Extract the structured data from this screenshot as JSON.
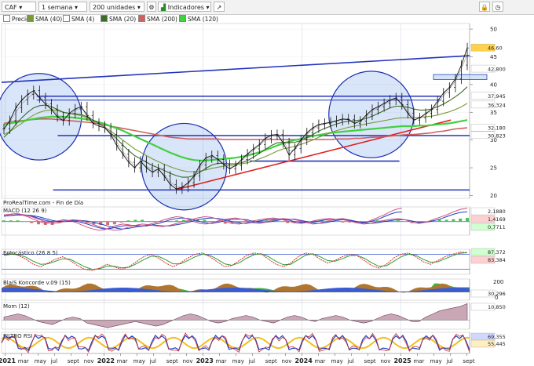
{
  "toolbar": {
    "symbol": "CAF",
    "interval": "1 semana",
    "units": "200 unidades",
    "indicators_label": "Indicadores",
    "colors": {
      "bg": "#f2f2f2"
    }
  },
  "legend": [
    {
      "label": "Precio",
      "color": "#ffffff"
    },
    {
      "label": "SMA (40)",
      "color": "#7a9a3a"
    },
    {
      "label": "SMA (4)",
      "color": "#ffffff"
    },
    {
      "label": "SMA (20)",
      "color": "#3c6a2a"
    },
    {
      "label": "SMA (200)",
      "color": "#d06060"
    },
    {
      "label": "SMA (120)",
      "color": "#40d040"
    }
  ],
  "source_note": "ProRealTime.com - Fin de Día",
  "chart_data": [
    {
      "type": "line",
      "panel": "price",
      "ylim": [
        19.5,
        51
      ],
      "yticks": [
        20,
        25,
        30,
        35,
        40,
        45,
        50
      ],
      "price_labels": [
        {
          "text": "46,60",
          "value": 46.6,
          "color": "#ffd24a"
        },
        {
          "text": "42,800",
          "value": 42.8,
          "color": "#ffffff"
        },
        {
          "text": "37,945",
          "value": 37.945,
          "color": "#ffffff"
        },
        {
          "text": "36,324",
          "value": 36.324,
          "color": "#ffffff"
        },
        {
          "text": "32,180",
          "value": 32.18,
          "color": "#ffffff"
        },
        {
          "text": "30,823",
          "value": 30.823,
          "color": "#ffffff"
        }
      ],
      "hlines": [
        {
          "value": 37.9,
          "x0": 0.075,
          "x1": 0.94,
          "color": "#2233bb"
        },
        {
          "value": 30.8,
          "x0": 0.12,
          "x1": 1.0,
          "color": "#2233bb"
        },
        {
          "value": 26.2,
          "x0": 0.53,
          "x1": 0.85,
          "color": "#2233bb"
        },
        {
          "value": 21.0,
          "x0": 0.11,
          "x1": 1.0,
          "color": "#2233bb"
        }
      ],
      "trendlines": [
        {
          "x0": 0.0,
          "y0": 40.4,
          "x1": 1.0,
          "y1": 45.2,
          "color": "#2233bb"
        },
        {
          "x0": 0.37,
          "y0": 21.0,
          "x1": 0.96,
          "y1": 33.6,
          "color": "#dd2222"
        }
      ],
      "circles": [
        {
          "cx": 0.08,
          "cy": 34.2,
          "r": 7.8
        },
        {
          "cx": 0.39,
          "cy": 25.2,
          "r": 7.8
        },
        {
          "cx": 0.79,
          "cy": 34.6,
          "r": 7.8
        }
      ],
      "price": [
        32.0,
        33.5,
        35.8,
        37.2,
        38.2,
        38.9,
        37.6,
        36.5,
        35.5,
        34.2,
        33.5,
        34.8,
        35.6,
        36.0,
        34.4,
        33.0,
        32.5,
        32.2,
        31.0,
        29.0,
        27.5,
        26.0,
        25.0,
        26.2,
        25.0,
        24.2,
        24.8,
        23.5,
        22.0,
        21.2,
        21.5,
        22.3,
        23.5,
        25.5,
        26.8,
        27.2,
        26.5,
        25.6,
        24.8,
        25.4,
        26.5,
        27.5,
        28.4,
        29.2,
        30.3,
        30.9,
        31.0,
        29.5,
        27.3,
        28.5,
        30.0,
        31.3,
        32.2,
        32.8,
        33.0,
        33.2,
        33.5,
        33.8,
        33.7,
        33.0,
        33.4,
        34.5,
        35.5,
        36.0,
        36.6,
        37.2,
        37.6,
        36.4,
        34.8,
        33.6,
        34.0,
        34.8,
        35.5,
        37.0,
        38.5,
        39.5,
        41.0,
        43.5,
        46.6
      ],
      "sma40": [
        31.0,
        31.5,
        32.3,
        33.0,
        33.8,
        34.5,
        35.0,
        35.3,
        35.4,
        35.3,
        35.0,
        34.8,
        34.6,
        34.4,
        34.0,
        33.5,
        33.0,
        32.3,
        31.6,
        30.8,
        30.0,
        29.2,
        28.4,
        27.8,
        27.2,
        26.6,
        26.1,
        25.6,
        25.2,
        24.8,
        24.5,
        24.3,
        24.3,
        24.4,
        24.6,
        24.9,
        25.1,
        25.3,
        25.4,
        25.5,
        25.7,
        25.9,
        26.2,
        26.6,
        27.0,
        27.5,
        28.0,
        28.4,
        28.6,
        28.9,
        29.2,
        29.6,
        30.0,
        30.5,
        30.9,
        31.3,
        31.7,
        32.0,
        32.3,
        32.5,
        32.7,
        32.9,
        33.1,
        33.3,
        33.5,
        33.7,
        33.9,
        34.0,
        34.0,
        34.0,
        34.1,
        34.2,
        34.3,
        34.5,
        34.8,
        35.1,
        35.5,
        36.0,
        36.6
      ],
      "sma20": [
        30.5,
        31.5,
        32.8,
        34.0,
        35.0,
        35.8,
        36.2,
        36.3,
        36.0,
        35.5,
        35.0,
        34.8,
        34.7,
        34.6,
        34.2,
        33.6,
        33.0,
        32.2,
        31.3,
        30.2,
        29.1,
        28.1,
        27.2,
        26.6,
        26.0,
        25.4,
        25.0,
        24.5,
        24.0,
        23.6,
        23.3,
        23.3,
        23.6,
        24.2,
        24.9,
        25.5,
        25.8,
        25.8,
        25.7,
        25.7,
        25.9,
        26.3,
        26.9,
        27.6,
        28.3,
        29.0,
        29.5,
        29.6,
        29.5,
        29.6,
        29.9,
        30.4,
        31.0,
        31.6,
        32.1,
        32.5,
        32.9,
        33.2,
        33.4,
        33.5,
        33.6,
        33.9,
        34.3,
        34.8,
        35.3,
        35.8,
        36.1,
        36.1,
        35.9,
        35.6,
        35.4,
        35.4,
        35.6,
        36.0,
        36.5,
        37.1,
        37.8,
        38.6,
        39.6
      ],
      "sma200": [
        33.0,
        33.2,
        33.4,
        33.5,
        33.6,
        33.7,
        33.8,
        33.8,
        33.8,
        33.7,
        33.6,
        33.5,
        33.4,
        33.3,
        33.2,
        33.1,
        32.9,
        32.7,
        32.5,
        32.3,
        32.1,
        31.9,
        31.7,
        31.5,
        31.3,
        31.1,
        30.9,
        30.7,
        30.5,
        30.4,
        30.3,
        30.2,
        30.2,
        30.2,
        30.2,
        30.2,
        30.2,
        30.1,
        30.1,
        30.1,
        30.1,
        30.1,
        30.1,
        30.1,
        30.1,
        30.1,
        30.1,
        30.1,
        30.1,
        30.1,
        30.1,
        30.1,
        30.1,
        30.1,
        30.1,
        30.1,
        30.2,
        30.2,
        30.2,
        30.3,
        30.3,
        30.4,
        30.5,
        30.5,
        30.6,
        30.7,
        30.8,
        30.9,
        31.0,
        31.0,
        31.1,
        31.2,
        31.3,
        31.5,
        31.6,
        31.8,
        32.0,
        32.1,
        32.2
      ],
      "sma120": [
        32.8,
        33.0,
        33.2,
        33.4,
        33.6,
        33.8,
        34.0,
        34.1,
        34.2,
        34.2,
        34.2,
        34.1,
        34.0,
        33.9,
        33.7,
        33.5,
        33.2,
        32.9,
        32.5,
        32.1,
        31.7,
        31.2,
        30.7,
        30.2,
        29.7,
        29.2,
        28.7,
        28.2,
        27.7,
        27.3,
        26.9,
        26.6,
        26.4,
        26.3,
        26.3,
        26.4,
        26.5,
        26.6,
        26.7,
        26.8,
        27.0,
        27.2,
        27.5,
        27.8,
        28.2,
        28.6,
        29.0,
        29.4,
        29.7,
        30.0,
        30.2,
        30.5,
        30.7,
        30.9,
        31.1,
        31.3,
        31.4,
        31.5,
        31.6,
        31.7,
        31.8,
        31.9,
        32.0,
        32.1,
        32.2,
        32.3,
        32.4,
        32.5,
        32.5,
        32.5,
        32.6,
        32.6,
        32.7,
        32.8,
        32.9,
        33.0,
        33.2,
        33.4,
        33.6
      ],
      "sma4": [
        32.0,
        33.2,
        35.0,
        36.5,
        37.5,
        38.5,
        37.8,
        36.9,
        35.8,
        34.6,
        33.8,
        34.5,
        35.3,
        35.8,
        34.8,
        33.4,
        32.8,
        32.3,
        31.3,
        29.6,
        28.0,
        26.5,
        25.4,
        25.8,
        25.3,
        24.6,
        24.6,
        23.8,
        22.5,
        21.6,
        21.4,
        22.1,
        23.2,
        25.0,
        26.4,
        27.0,
        26.6,
        25.8,
        25.1,
        25.3,
        26.2,
        27.2,
        28.1,
        29.0,
        30.0,
        30.7,
        30.9,
        29.9,
        28.0,
        28.3,
        29.6,
        31.0,
        32.0,
        32.6,
        32.9,
        33.1,
        33.4,
        33.7,
        33.7,
        33.2,
        33.3,
        34.2,
        35.2,
        35.8,
        36.4,
        37.0,
        37.5,
        36.6,
        35.2,
        34.0,
        34.0,
        34.6,
        35.3,
        36.6,
        38.0,
        39.2,
        40.6,
        42.8,
        45.5
      ]
    },
    {
      "type": "line",
      "panel": "MACD",
      "title": "MACD (12 26 9)",
      "ylim": [
        -2.2,
        2.4
      ],
      "value_labels": [
        "2,1880",
        "1,4169",
        "0,7711"
      ],
      "macd": [
        1.1,
        1.2,
        1.3,
        1.1,
        0.8,
        0.4,
        0.0,
        -0.3,
        -0.2,
        0.1,
        0.3,
        0.2,
        -0.1,
        -0.5,
        -0.9,
        -1.2,
        -1.4,
        -1.3,
        -0.9,
        -0.6,
        -0.4,
        -0.5,
        -0.7,
        -0.8,
        -0.6,
        -0.3,
        0.0,
        0.3,
        0.6,
        0.8,
        0.7,
        0.4,
        0.0,
        -0.3,
        -0.4,
        -0.2,
        0.1,
        0.3,
        0.5,
        0.6,
        0.4,
        0.1,
        -0.2,
        -0.3,
        -0.1,
        0.2,
        0.4,
        0.5,
        0.4,
        0.3,
        0.1,
        -0.2,
        -0.4,
        -0.3,
        0.0,
        0.2,
        0.4,
        0.5,
        0.3,
        -0.1,
        -0.3,
        -0.1,
        0.3,
        0.7,
        1.1,
        1.6,
        2.0,
        2.2
      ],
      "signal": [
        0.9,
        1.0,
        1.1,
        1.1,
        1.0,
        0.8,
        0.5,
        0.2,
        0.0,
        0.0,
        0.1,
        0.2,
        0.1,
        -0.1,
        -0.4,
        -0.7,
        -1.0,
        -1.2,
        -1.1,
        -0.9,
        -0.7,
        -0.6,
        -0.6,
        -0.7,
        -0.7,
        -0.5,
        -0.3,
        0.0,
        0.3,
        0.5,
        0.6,
        0.5,
        0.3,
        0.0,
        -0.2,
        -0.3,
        -0.1,
        0.1,
        0.3,
        0.4,
        0.4,
        0.3,
        0.0,
        -0.1,
        -0.1,
        0.0,
        0.2,
        0.4,
        0.4,
        0.4,
        0.2,
        0.0,
        -0.2,
        -0.3,
        -0.2,
        0.0,
        0.2,
        0.3,
        0.3,
        0.1,
        -0.1,
        -0.1,
        0.1,
        0.4,
        0.8,
        1.2,
        1.5,
        1.6
      ]
    },
    {
      "type": "line",
      "panel": "Stochastic",
      "title": "Estocástico (26 8 5)",
      "ylim": [
        0,
        100
      ],
      "value_labels": [
        "87,372",
        "83,384"
      ],
      "k": [
        80,
        85,
        75,
        60,
        40,
        30,
        45,
        60,
        70,
        55,
        35,
        20,
        15,
        25,
        40,
        30,
        20,
        30,
        50,
        70,
        80,
        65,
        45,
        30,
        45,
        65,
        80,
        85,
        70,
        50,
        30,
        35,
        55,
        75,
        85,
        80,
        60,
        40,
        30,
        45,
        70,
        85,
        80,
        60,
        45,
        55,
        70,
        80,
        75,
        55,
        35,
        25,
        40,
        65,
        80,
        85,
        70,
        50,
        40,
        55,
        70,
        80,
        88,
        87
      ],
      "d": [
        75,
        80,
        78,
        68,
        52,
        40,
        42,
        52,
        62,
        60,
        45,
        30,
        20,
        22,
        32,
        32,
        26,
        28,
        42,
        58,
        72,
        72,
        58,
        42,
        42,
        55,
        70,
        80,
        76,
        60,
        42,
        36,
        46,
        64,
        78,
        82,
        70,
        52,
        38,
        40,
        58,
        76,
        82,
        70,
        55,
        52,
        62,
        74,
        76,
        64,
        46,
        32,
        34,
        52,
        70,
        80,
        76,
        60,
        48,
        50,
        62,
        74,
        84,
        86
      ]
    },
    {
      "type": "area",
      "panel": "BlaiS Koncorde",
      "title": "BlaiS Koncorde v.09 (15)",
      "value_labels": [
        "30,296"
      ]
    },
    {
      "type": "area",
      "panel": "Momentum",
      "title": "Mom (12)",
      "value_labels": [
        "10,850"
      ],
      "values": [
        2,
        3,
        4,
        3,
        1,
        -1,
        -2,
        -3,
        -1,
        1,
        2,
        1,
        -2,
        -3,
        -4,
        -5,
        -4,
        -3,
        -2,
        -1,
        -2,
        -3,
        -4,
        -3,
        -1,
        1,
        3,
        4,
        3,
        1,
        -1,
        -2,
        -1,
        1,
        2,
        3,
        2,
        0,
        -1,
        -2,
        0,
        2,
        3,
        2,
        0,
        -1,
        1,
        2,
        3,
        2,
        0,
        -1,
        -2,
        -1,
        1,
        3,
        4,
        3,
        1,
        -1,
        -1,
        2,
        4,
        6,
        7,
        8,
        9,
        10.8
      ]
    },
    {
      "type": "line",
      "panel": "FILTRO RSI",
      "title": "FILTRO RSI",
      "value_labels": [
        "69,355",
        "55,445"
      ]
    }
  ],
  "x_axis_labels": [
    "2021",
    "mar",
    "may",
    "jul",
    "sept",
    "nov",
    "2022",
    "mar",
    "may",
    "jul",
    "sept",
    "nov",
    "2023",
    "mar",
    "may",
    "jul",
    "sept",
    "nov",
    "2024",
    "mar",
    "may",
    "jul",
    "sept",
    "nov",
    "2025",
    "mar",
    "may",
    "jul",
    "sept"
  ]
}
